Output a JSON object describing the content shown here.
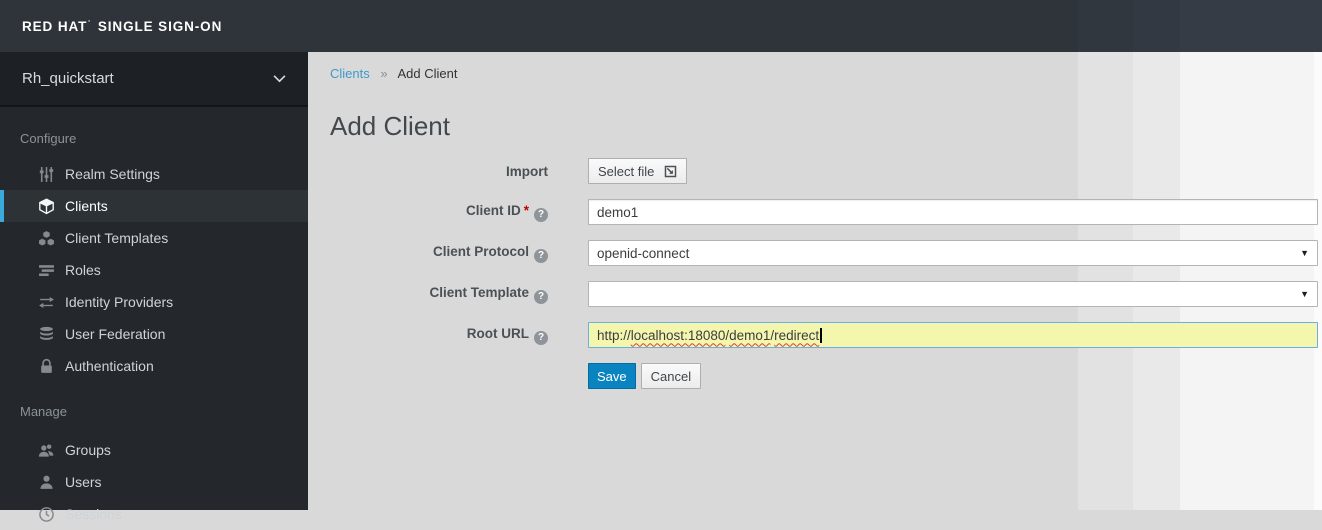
{
  "topbar": {
    "brand_bold": "RED HAT",
    "brand_mark": "'",
    "brand_rest": "SINGLE SIGN-ON"
  },
  "sidebar": {
    "realm": "Rh_quickstart",
    "sections": [
      {
        "label": "Configure",
        "items": [
          {
            "label": "Realm Settings",
            "icon": "sliders-icon",
            "selected": false
          },
          {
            "label": "Clients",
            "icon": "cube-icon",
            "selected": true
          },
          {
            "label": "Client Templates",
            "icon": "cubes-icon",
            "selected": false
          },
          {
            "label": "Roles",
            "icon": "list-icon",
            "selected": false
          },
          {
            "label": "Identity Providers",
            "icon": "exchange-arrows-icon",
            "selected": false
          },
          {
            "label": "User Federation",
            "icon": "database-icon",
            "selected": false
          },
          {
            "label": "Authentication",
            "icon": "lock-icon",
            "selected": false
          }
        ]
      },
      {
        "label": "Manage",
        "items": [
          {
            "label": "Groups",
            "icon": "groups-icon",
            "selected": false
          },
          {
            "label": "Users",
            "icon": "user-icon",
            "selected": false
          },
          {
            "label": "Sessions",
            "icon": "clock-icon",
            "selected": false
          }
        ]
      }
    ]
  },
  "breadcrumb": {
    "link": "Clients",
    "separator": "»",
    "current": "Add Client"
  },
  "page": {
    "title": "Add Client"
  },
  "form": {
    "import": {
      "label": "Import",
      "button": "Select file"
    },
    "client_id": {
      "label": "Client ID",
      "required": "*",
      "value": "demo1"
    },
    "client_protocol": {
      "label": "Client Protocol",
      "value": "openid-connect"
    },
    "client_template": {
      "label": "Client Template",
      "value": ""
    },
    "root_url": {
      "label": "Root URL",
      "value": "http://localhost:18080/demo1/redirect",
      "parts": [
        "http://",
        "localhost:18080",
        "/",
        "demo1",
        "/",
        "redirect"
      ]
    },
    "save_label": "Save",
    "cancel_label": "Cancel"
  },
  "icons": {
    "help": "?",
    "select_caret": "▼"
  },
  "colors": {
    "topbar_bg": "#2f343a",
    "sidebar_bg": "#24282d",
    "active_accent": "#3aa9dc",
    "link": "#3d9bc9",
    "primary_button": "#0a84c1",
    "highlight_yellow": "#f5f6ad",
    "focus_border": "#66afe9",
    "required_red": "#c00000"
  }
}
